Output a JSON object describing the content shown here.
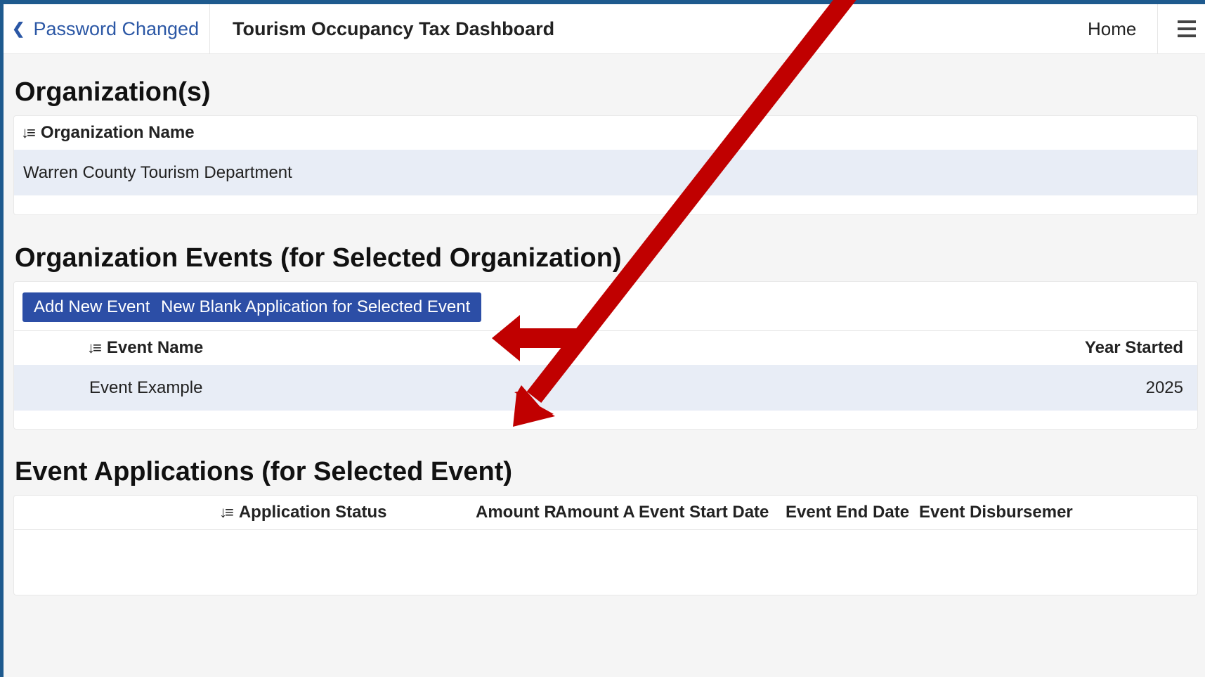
{
  "topbar": {
    "back_label": "Password Changed",
    "title": "Tourism Occupancy Tax Dashboard",
    "home_label": "Home"
  },
  "organizations": {
    "heading": "Organization(s)",
    "column": "Organization Name",
    "rows": [
      "Warren County Tourism Department"
    ]
  },
  "events": {
    "heading": "Organization Events (for Selected Organization)",
    "add_button": "Add New Event",
    "new_app_button": "New Blank Application for Selected Event",
    "columns": {
      "name": "Event Name",
      "year": "Year Started"
    },
    "rows": [
      {
        "name": "Event Example",
        "year": "2025"
      }
    ]
  },
  "applications": {
    "heading": "Event Applications (for Selected Event)",
    "columns": {
      "status": "Application Status",
      "amount_r": "Amount R",
      "amount_a": "Amount A",
      "start": "Event Start Date",
      "end": "Event End Date",
      "disbursement": "Event Disbursemer"
    }
  },
  "annotation_color": "#c00000",
  "accent_color": "#2c4ea6",
  "link_color": "#2b57a5"
}
